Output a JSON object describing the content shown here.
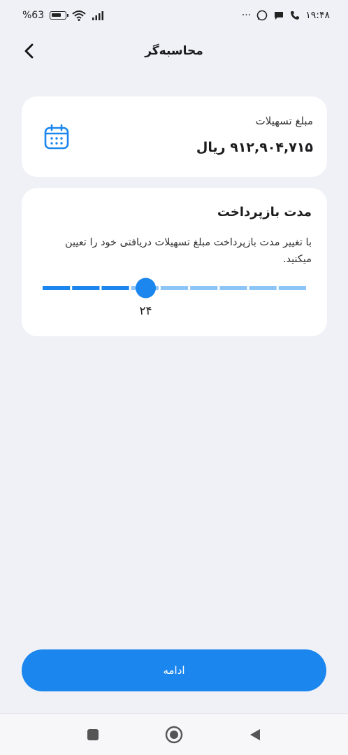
{
  "status_bar": {
    "battery": "%63",
    "time": "۱۹:۴۸",
    "dots": "···"
  },
  "header": {
    "title": "محاسبه‌گر"
  },
  "loan_card": {
    "label": "مبلغ تسهیلات",
    "amount": "۹۱۲,۹۰۴,۷۱۵ ریال"
  },
  "term_card": {
    "title": "مدت بازپرداخت",
    "description": "با تغییر مدت بازپرداخت مبلغ تسهیلات دریافتی خود را تعیین میکنید.",
    "selected_value": "۲۴",
    "slider": {
      "segments": 9,
      "selected_fraction": 0.333
    }
  },
  "continue_button": {
    "label": "ادامه"
  },
  "colors": {
    "accent": "#1a86ee",
    "track_inactive": "#8ec5f7",
    "background": "#eff1f7"
  },
  "icons": {
    "back": "chevron-left-icon",
    "calendar": "calendar-icon",
    "nav_recents": "square-icon",
    "nav_home": "circle-icon",
    "nav_back": "triangle-icon"
  }
}
